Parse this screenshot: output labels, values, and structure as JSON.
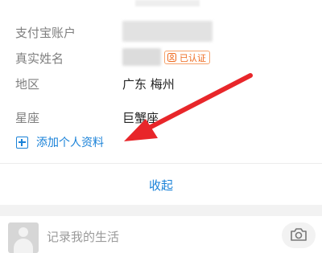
{
  "profile": {
    "alipay_account": {
      "label": "支付宝账户"
    },
    "real_name": {
      "label": "真实姓名",
      "badge": "已认证"
    },
    "region": {
      "label": "地区",
      "value": "广东 梅州"
    },
    "constellation": {
      "label": "星座",
      "value": "巨蟹座"
    }
  },
  "add_info_link": "添加个人资料",
  "collapse_label": "收起",
  "composer": {
    "placeholder": "记录我的生活",
    "icons": {
      "avatar": "user-avatar-icon",
      "camera": "camera-icon"
    }
  },
  "annotation": {
    "arrow_color": "#e8262a"
  },
  "colors": {
    "link_blue": "#1a82d8",
    "badge_orange": "#ee6a1f",
    "label_gray": "#7f7f7f"
  }
}
